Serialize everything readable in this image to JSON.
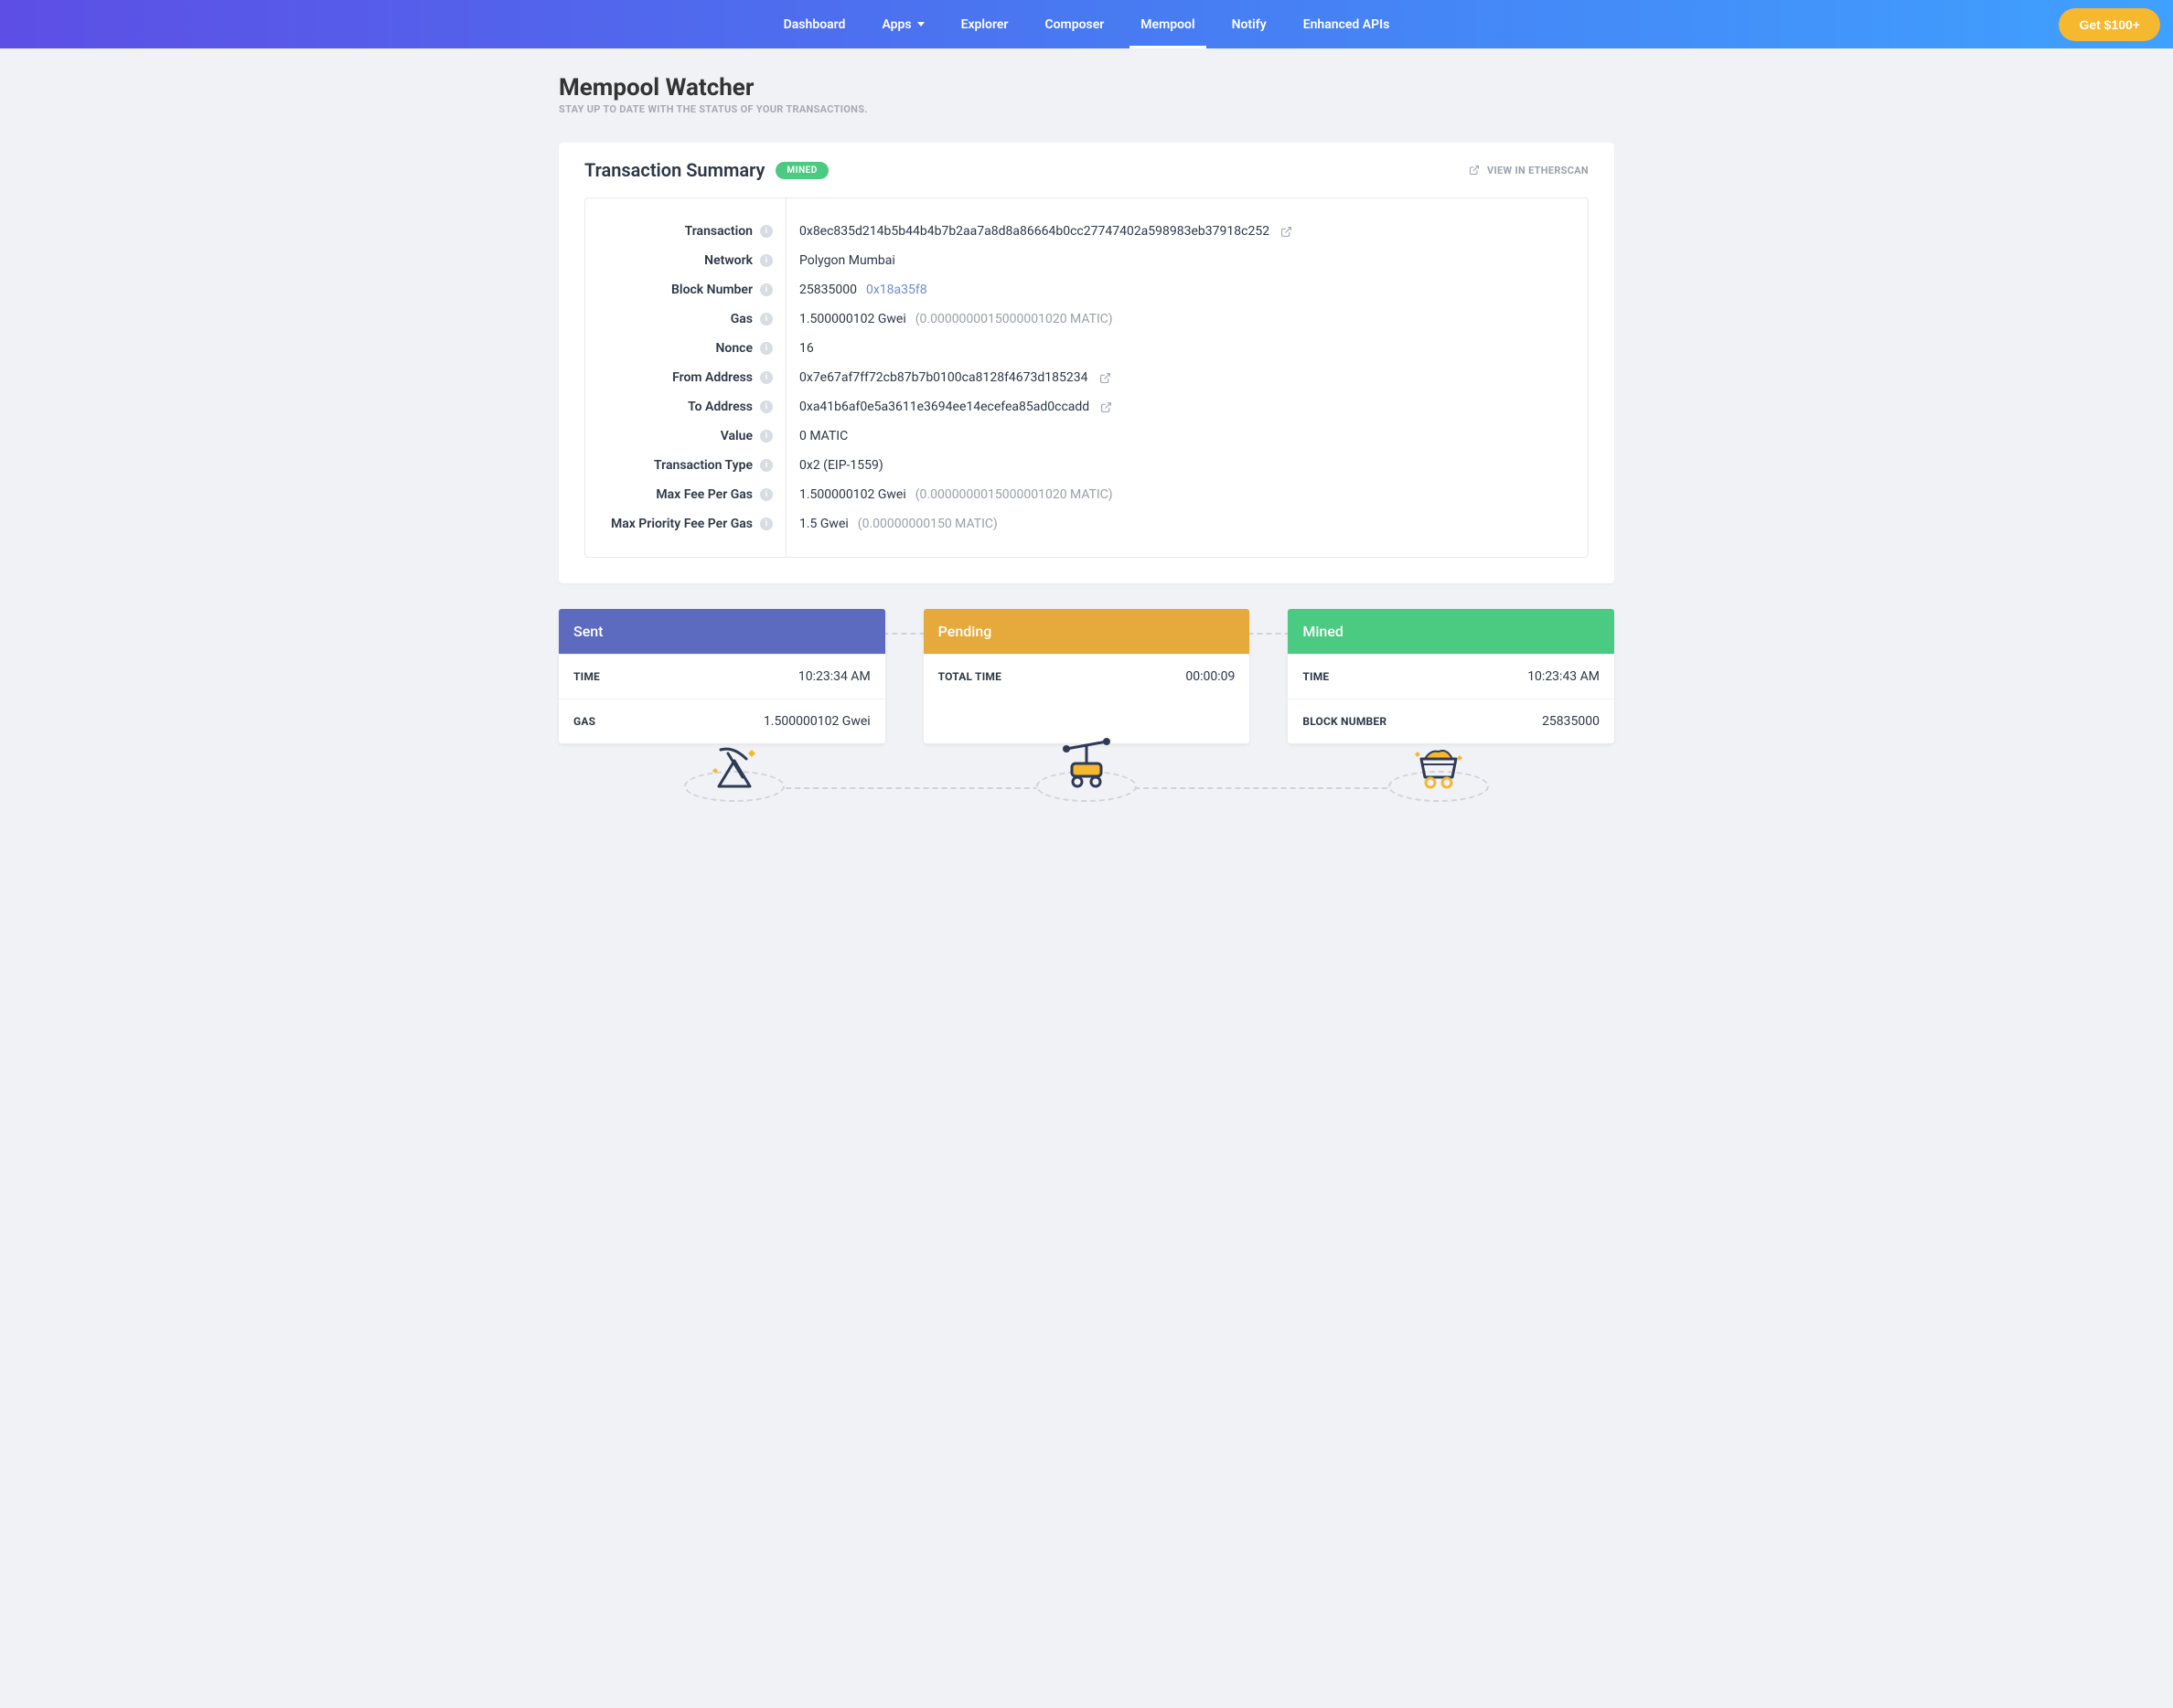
{
  "nav": {
    "items": [
      {
        "label": "Dashboard"
      },
      {
        "label": "Apps",
        "hasCaret": true
      },
      {
        "label": "Explorer"
      },
      {
        "label": "Composer"
      },
      {
        "label": "Mempool",
        "active": true
      },
      {
        "label": "Notify"
      },
      {
        "label": "Enhanced APIs"
      }
    ],
    "cta": "Get $100+"
  },
  "page": {
    "title": "Mempool Watcher",
    "subtitle": "STAY UP TO DATE WITH THE STATUS OF YOUR TRANSACTIONS."
  },
  "summary": {
    "title": "Transaction Summary",
    "badge": "MINED",
    "etherscanLabel": "VIEW IN ETHERSCAN",
    "fields": {
      "transaction": {
        "label": "Transaction",
        "value": "0x8ec835d214b5b44b4b7b2aa7a8d8a86664b0cc27747402a598983eb37918c252",
        "ext": true
      },
      "network": {
        "label": "Network",
        "value": "Polygon Mumbai"
      },
      "blockNumber": {
        "label": "Block Number",
        "value": "25835000",
        "hex": "0x18a35f8"
      },
      "gas": {
        "label": "Gas",
        "value": "1.500000102 Gwei",
        "secondary": "(0.0000000015000001020 MATIC)"
      },
      "nonce": {
        "label": "Nonce",
        "value": "16"
      },
      "from": {
        "label": "From Address",
        "value": "0x7e67af7ff72cb87b7b0100ca8128f4673d185234",
        "ext": true
      },
      "to": {
        "label": "To Address",
        "value": "0xa41b6af0e5a3611e3694ee14ecefea85ad0ccadd",
        "ext": true
      },
      "value": {
        "label": "Value",
        "value": "0 MATIC"
      },
      "txType": {
        "label": "Transaction Type",
        "value": "0x2 (EIP-1559)"
      },
      "maxFee": {
        "label": "Max Fee Per Gas",
        "value": "1.500000102 Gwei",
        "secondary": "(0.0000000015000001020 MATIC)"
      },
      "maxPriority": {
        "label": "Max Priority Fee Per Gas",
        "value": "1.5 Gwei",
        "secondary": "(0.00000000150 MATIC)"
      }
    }
  },
  "status": {
    "sent": {
      "title": "Sent",
      "rows": [
        {
          "label": "TIME",
          "value": "10:23:34 AM"
        },
        {
          "label": "GAS",
          "value": "1.500000102 Gwei"
        }
      ]
    },
    "pending": {
      "title": "Pending",
      "rows": [
        {
          "label": "TOTAL TIME",
          "value": "00:00:09"
        }
      ]
    },
    "mined": {
      "title": "Mined",
      "rows": [
        {
          "label": "TIME",
          "value": "10:23:43 AM"
        },
        {
          "label": "BLOCK NUMBER",
          "value": "25835000"
        }
      ]
    }
  },
  "colors": {
    "sent": "#5c6bc0",
    "pending": "#e5a93c",
    "mined": "#4bca81"
  }
}
